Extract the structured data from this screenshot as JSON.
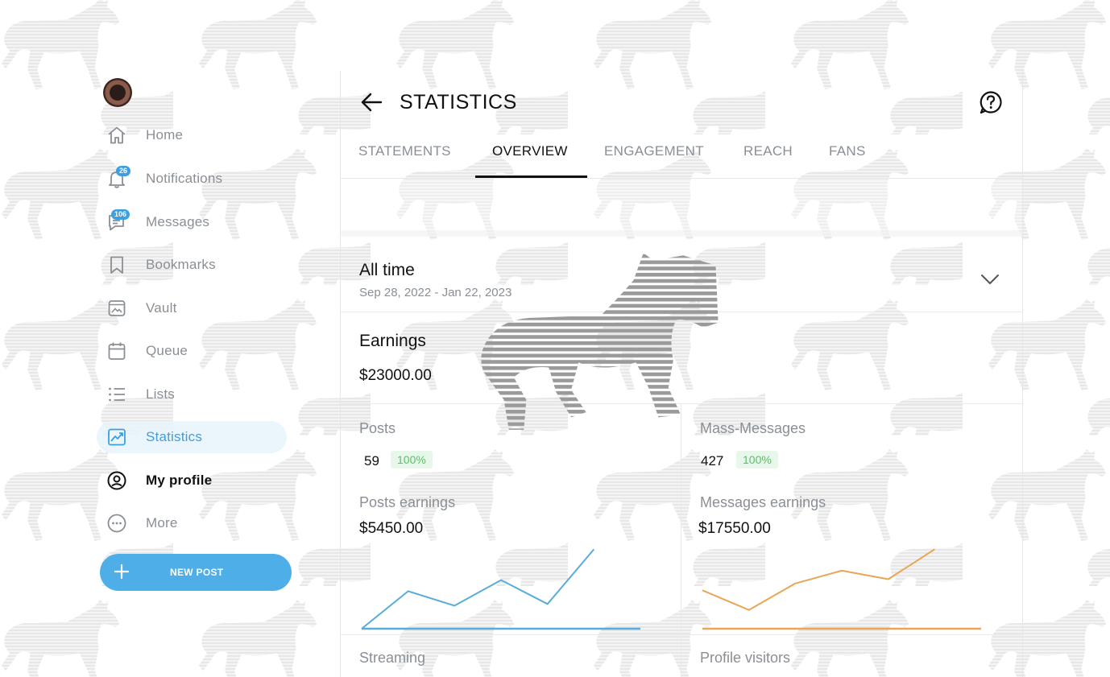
{
  "sidebar": {
    "items": [
      {
        "label": "Home",
        "icon": "home-icon"
      },
      {
        "label": "Notifications",
        "icon": "bell-icon",
        "badge": "26"
      },
      {
        "label": "Messages",
        "icon": "message-icon",
        "badge": "106"
      },
      {
        "label": "Bookmarks",
        "icon": "bookmark-icon"
      },
      {
        "label": "Vault",
        "icon": "vault-icon"
      },
      {
        "label": "Queue",
        "icon": "calendar-icon"
      },
      {
        "label": "Lists",
        "icon": "list-icon"
      },
      {
        "label": "Statistics",
        "icon": "chart-icon",
        "active": true
      },
      {
        "label": "My profile",
        "icon": "profile-icon"
      },
      {
        "label": "More",
        "icon": "more-icon"
      }
    ],
    "new_post_label": "NEW POST"
  },
  "header": {
    "title": "STATISTICS"
  },
  "tabs": [
    {
      "label": "STATEMENTS"
    },
    {
      "label": "OVERVIEW",
      "active": true
    },
    {
      "label": "ENGAGEMENT"
    },
    {
      "label": "REACH"
    },
    {
      "label": "FANS"
    }
  ],
  "period": {
    "title": "All time",
    "range": "Sep 28, 2022 - Jan 22, 2023"
  },
  "earnings": {
    "title": "Earnings",
    "value": "$23000.00"
  },
  "cards": {
    "posts": {
      "title": "Posts",
      "count": "59",
      "percent": "100%",
      "sub_title": "Posts earnings",
      "amount": "$5450.00",
      "color": "#5aacd8"
    },
    "mass_messages": {
      "title": "Mass-Messages",
      "count": "427",
      "percent": "100%",
      "sub_title": "Messages earnings",
      "amount": "$17550.00",
      "color": "#e8a656"
    }
  },
  "bottom": {
    "streaming": "Streaming",
    "profile_visitors": "Profile visitors"
  },
  "colors": {
    "accent": "#3d9fe0",
    "button": "#4eaee8",
    "positive": "#5cc06a"
  },
  "chart_data": [
    {
      "type": "line",
      "x": [
        1,
        2,
        3,
        4,
        5,
        6,
        7
      ],
      "series": [
        {
          "values": [
            0,
            44,
            27,
            57,
            29,
            93
          ]
        },
        {
          "values": [
            0,
            0,
            0,
            0,
            0,
            0,
            0
          ]
        }
      ]
    },
    {
      "type": "line",
      "x": [
        1,
        2,
        3,
        4,
        5,
        6,
        7
      ],
      "series": [
        {
          "values": [
            45,
            22,
            53,
            68,
            58,
            93
          ]
        },
        {
          "values": [
            0,
            0,
            0,
            0,
            0,
            0,
            0
          ]
        }
      ]
    }
  ]
}
